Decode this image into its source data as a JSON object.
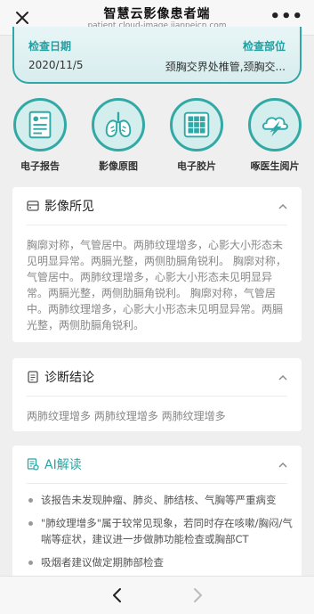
{
  "header": {
    "title": "智慧云影像患者端",
    "subtitle": "patient.cloud-image.jianpeicn.com",
    "close_icon": "close-icon",
    "more_icon": "more-icon",
    "more_glyph": "•••"
  },
  "exam": {
    "date_label": "检查日期",
    "date_value": "2020/11/5",
    "part_label": "检查部位",
    "part_value": "颈胸交界处椎管,颈胸交..."
  },
  "actions": [
    {
      "label": "电子报告",
      "icon": "report-icon"
    },
    {
      "label": "影像原图",
      "icon": "lungs-icon"
    },
    {
      "label": "电子胶片",
      "icon": "film-icon"
    },
    {
      "label": "啄医生阅片",
      "icon": "doctor-read-icon"
    }
  ],
  "findings": {
    "title": "影像所见",
    "text": "胸廓对称，气管居中。两肺纹理增多，心影大小形态未见明显异常。两膈光整，两侧肋膈角锐利。 胸廓对称，气管居中。两肺纹理增多，心影大小形态未见明显异常。两膈光整，两侧肋膈角锐利。 胸廓对称，气管居中。两肺纹理增多，心影大小形态未见明显异常。两膈光整，两侧肋膈角锐利。"
  },
  "diagnosis": {
    "title": "诊断结论",
    "text": "两肺纹理增多 两肺纹理增多 两肺纹理增多"
  },
  "ai": {
    "title": "AI解读",
    "items": [
      "该报告未发现肿瘤、肺炎、肺结核、气胸等严重病变",
      "\"肺纹理增多\"属于较常见现象，若同时存在咳嗽/胸闷/气喘等症状，建议进一步做肺功能检查或胸部CT",
      "吸烟者建议做定期肺部检查"
    ]
  },
  "colors": {
    "accent": "#2fa8a7",
    "accent_light": "#d4eeee"
  }
}
